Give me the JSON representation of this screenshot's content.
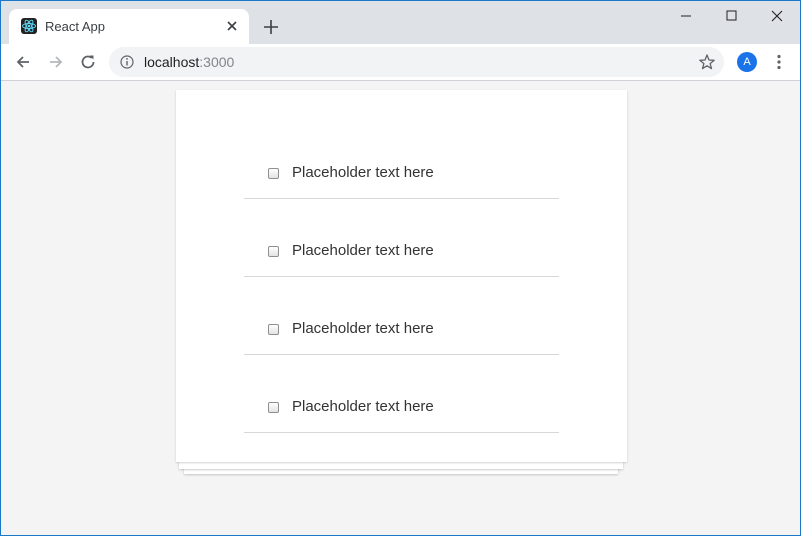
{
  "browser": {
    "tab_title": "React App",
    "url_host": "localhost",
    "url_port": ":3000",
    "profile_initial": "A",
    "accent_color": "#1a73e8"
  },
  "icons": {
    "favicon": "react-logo-icon",
    "tab_close": "close-icon",
    "new_tab": "plus-icon",
    "back": "arrow-left-icon",
    "forward": "arrow-right-icon",
    "reload": "reload-icon",
    "site_info": "info-icon",
    "bookmark": "star-icon",
    "menu": "kebab-menu-icon"
  },
  "todos": [
    {
      "label": "Placeholder text here",
      "checked": false
    },
    {
      "label": "Placeholder text here",
      "checked": false
    },
    {
      "label": "Placeholder text here",
      "checked": false
    },
    {
      "label": "Placeholder text here",
      "checked": false
    }
  ]
}
